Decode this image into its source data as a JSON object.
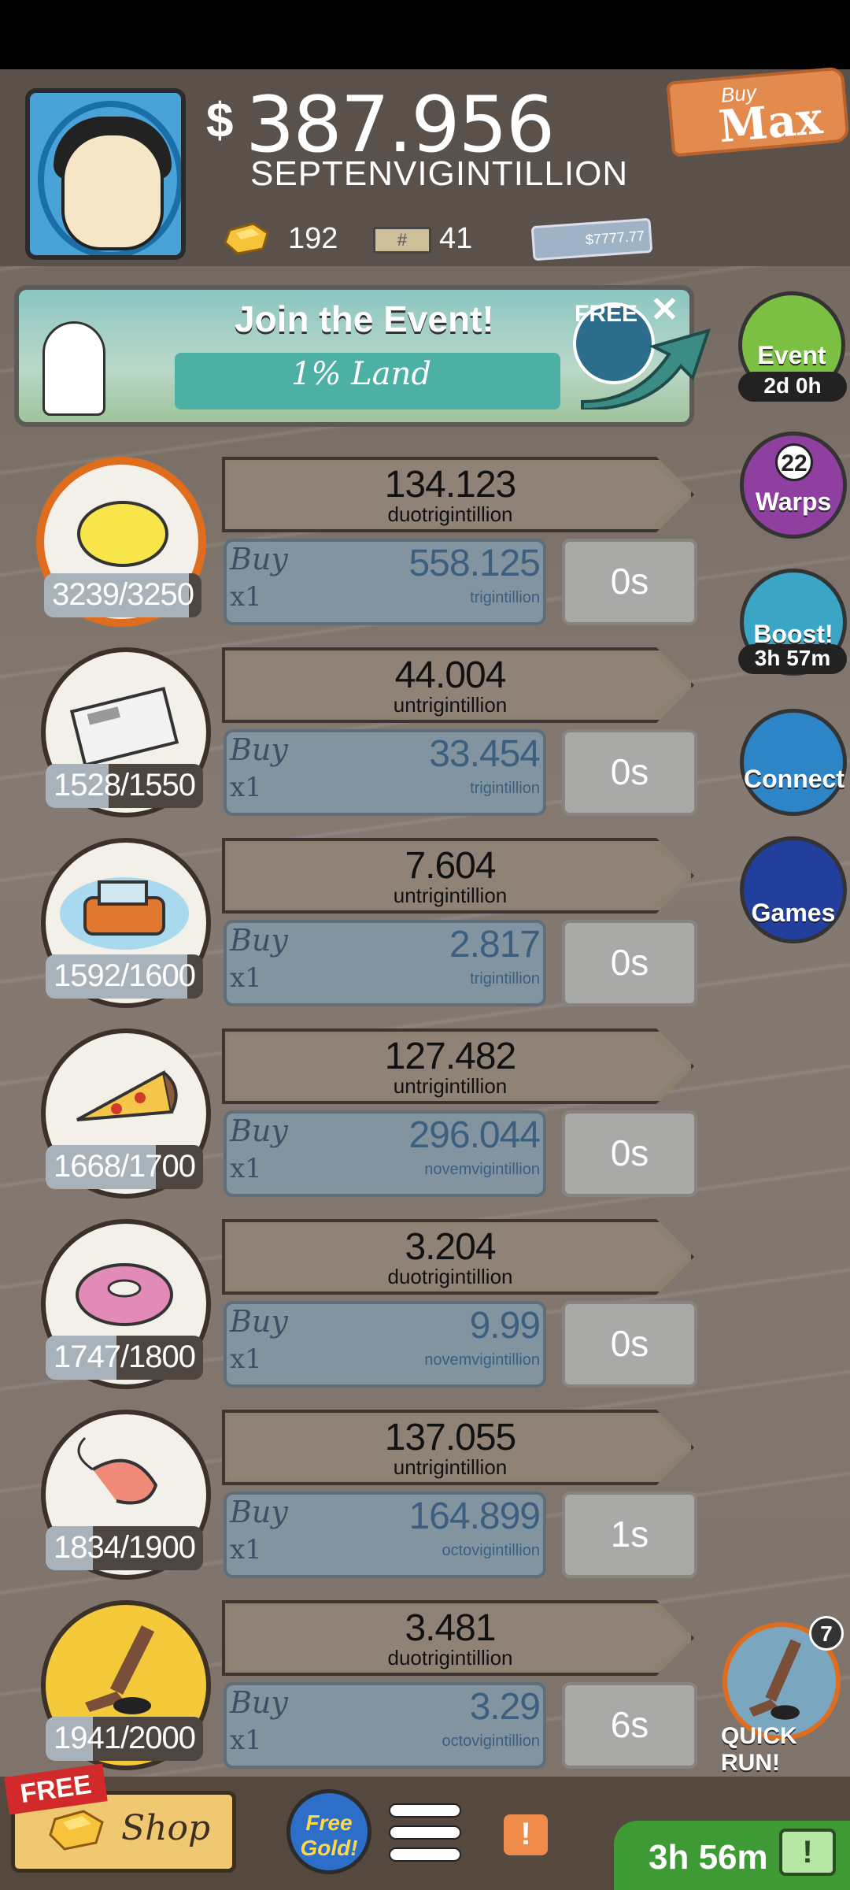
{
  "header": {
    "money_sign": "$",
    "money_value": "387.956",
    "money_unit": "SEPTENVIGINTILLION",
    "gold_count": "192",
    "megabucks_icon_text": "#",
    "megabucks_count": "41",
    "bill_text": "$7777.77",
    "buy_max_small": "Buy",
    "buy_max_big": "Max"
  },
  "event_banner": {
    "title": "Join the Event!",
    "subtitle": "1% Land",
    "free_label": "FREE"
  },
  "side_buttons": {
    "event_label": "Event",
    "event_timer": "2d 0h",
    "warps_count": "22",
    "warps_label": "Warps",
    "boost_label": "Boost!",
    "boost_timer": "3h 57m",
    "connect_label": "Connect",
    "games_label": "Games"
  },
  "businesses": [
    {
      "icon": "lemon-icon",
      "owned": "3239/3250",
      "progress": 0.92,
      "revenue": "134.123",
      "revenue_unit": "duotrigintillion",
      "buy_label": "Buy",
      "buy_mult": "x1",
      "cost": "558.125",
      "cost_unit": "trigintillion",
      "time": "0s"
    },
    {
      "icon": "newspaper-icon",
      "owned": "1528/1550",
      "progress": 0.4,
      "revenue": "44.004",
      "revenue_unit": "untrigintillion",
      "buy_label": "Buy",
      "buy_mult": "x1",
      "cost": "33.454",
      "cost_unit": "trigintillion",
      "time": "0s"
    },
    {
      "icon": "car-icon",
      "owned": "1592/1600",
      "progress": 0.9,
      "revenue": "7.604",
      "revenue_unit": "untrigintillion",
      "buy_label": "Buy",
      "buy_mult": "x1",
      "cost": "2.817",
      "cost_unit": "trigintillion",
      "time": "0s"
    },
    {
      "icon": "pizza-icon",
      "owned": "1668/1700",
      "progress": 0.7,
      "revenue": "127.482",
      "revenue_unit": "untrigintillion",
      "buy_label": "Buy",
      "buy_mult": "x1",
      "cost": "296.044",
      "cost_unit": "novemvigintillion",
      "time": "0s"
    },
    {
      "icon": "donut-icon",
      "owned": "1747/1800",
      "progress": 0.45,
      "revenue": "3.204",
      "revenue_unit": "duotrigintillion",
      "buy_label": "Buy",
      "buy_mult": "x1",
      "cost": "9.99",
      "cost_unit": "novemvigintillion",
      "time": "0s"
    },
    {
      "icon": "shrimp-icon",
      "owned": "1834/1900",
      "progress": 0.3,
      "revenue": "137.055",
      "revenue_unit": "untrigintillion",
      "buy_label": "Buy",
      "buy_mult": "x1",
      "cost": "164.899",
      "cost_unit": "octovigintillion",
      "time": "1s"
    },
    {
      "icon": "hockey-icon",
      "owned": "1941/2000",
      "progress": 0.3,
      "revenue": "3.481",
      "revenue_unit": "duotrigintillion",
      "buy_label": "Buy",
      "buy_mult": "x1",
      "cost": "3.29",
      "cost_unit": "octovigintillion",
      "time": "6s"
    }
  ],
  "quick_run": {
    "badge": "7",
    "label": "QUICK RUN!"
  },
  "bottom_bar": {
    "free_tag": "FREE",
    "shop_label": "Shop",
    "free_gold_line1": "Free",
    "free_gold_line2": "Gold!",
    "alert_icon": "!",
    "timer": "3h 56m",
    "tv_icon": "!"
  },
  "colors": {
    "accent_orange": "#e06c1d",
    "background": "#7a6f66",
    "timer_green": "#3e9a34"
  }
}
